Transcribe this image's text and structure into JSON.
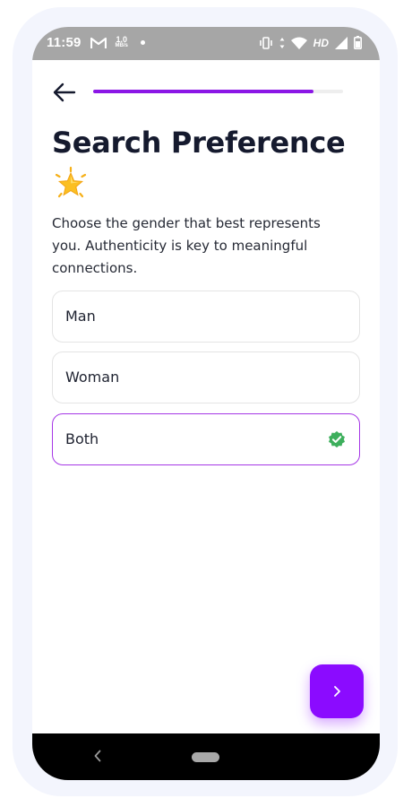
{
  "status_bar": {
    "time": "11:59",
    "network_speed_value": "1.0",
    "network_speed_unit": "MB/s",
    "network_type": "HD",
    "icons": [
      "gmail-icon",
      "dot-icon",
      "vibrate-icon",
      "data-arrows-icon",
      "wifi-icon",
      "signal-icon",
      "battery-icon"
    ]
  },
  "header": {
    "back_icon": "arrow-left-icon",
    "progress": 0.88
  },
  "title": "Search Preference",
  "title_emoji": "star-emoji",
  "subtitle": "Choose the gender that best represents you. Authenticity is key to meaningful connections.",
  "options": [
    {
      "label": "Man",
      "selected": false
    },
    {
      "label": "Woman",
      "selected": false
    },
    {
      "label": "Both",
      "selected": true
    }
  ],
  "next_button": {
    "icon": "chevron-right-icon"
  },
  "nav_bar": {
    "icons": [
      "nav-back-icon",
      "home-pill-icon"
    ]
  },
  "colors": {
    "accent": "#8b0bff",
    "progress": "#8b17e6",
    "selected_border": "#a637e6",
    "check": "#3daf5c",
    "title": "#151a2e"
  }
}
